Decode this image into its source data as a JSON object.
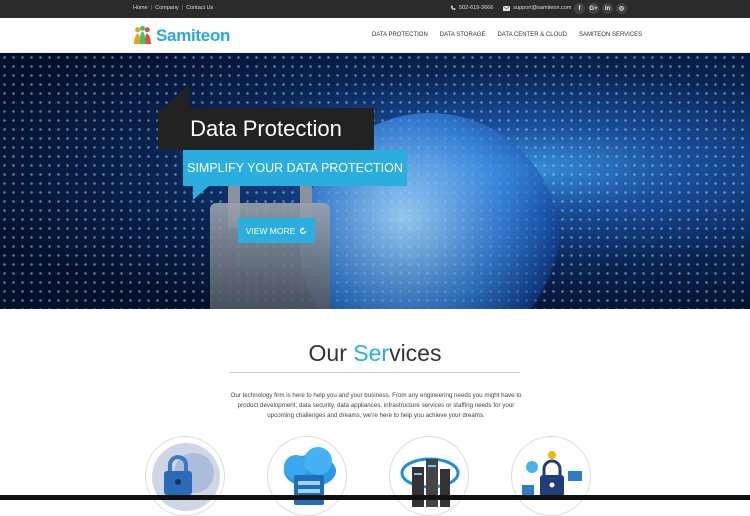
{
  "topbar": {
    "links": [
      "Home",
      "Company",
      "Contact Us"
    ],
    "separator": "|",
    "phone": "502-619-3666",
    "email": "support@samiteon.com",
    "social": [
      {
        "icon": "facebook-icon",
        "glyph": "f"
      },
      {
        "icon": "google-plus-icon",
        "glyph": "G+"
      },
      {
        "icon": "linkedin-icon",
        "glyph": "in"
      },
      {
        "icon": "instagram-icon",
        "glyph": "◎"
      }
    ]
  },
  "nav": {
    "brand": "Samiteon",
    "menu": [
      "DATA PROTECTION",
      "DATA STORAGE",
      "DATA CENTER & CLOUD",
      "SAMITEON SERVICES"
    ]
  },
  "hero": {
    "title": "Data Protection",
    "subtitle": "SIMPLIFY YOUR DATA PROTECTION",
    "cta": "VIEW MORE",
    "cta_icon": "refresh-icon"
  },
  "services": {
    "title_part1": "Our ",
    "title_highlight": "Ser",
    "title_part2": "vices",
    "description": "Our technology firm is here to help you and your business. From any engineering needs you might have to product development, data security, data appliances, infrastructure services or staffing needs for your upcoming challenges and dreams, we're here to help you achieve your dreams.",
    "icons": [
      "padlock-icon",
      "cloud-storage-icon",
      "data-center-cloud-icon",
      "network-lock-icon"
    ]
  },
  "colors": {
    "accent": "#2aaee0",
    "topbar": "#2b2b2b",
    "title_box": "#222222"
  }
}
